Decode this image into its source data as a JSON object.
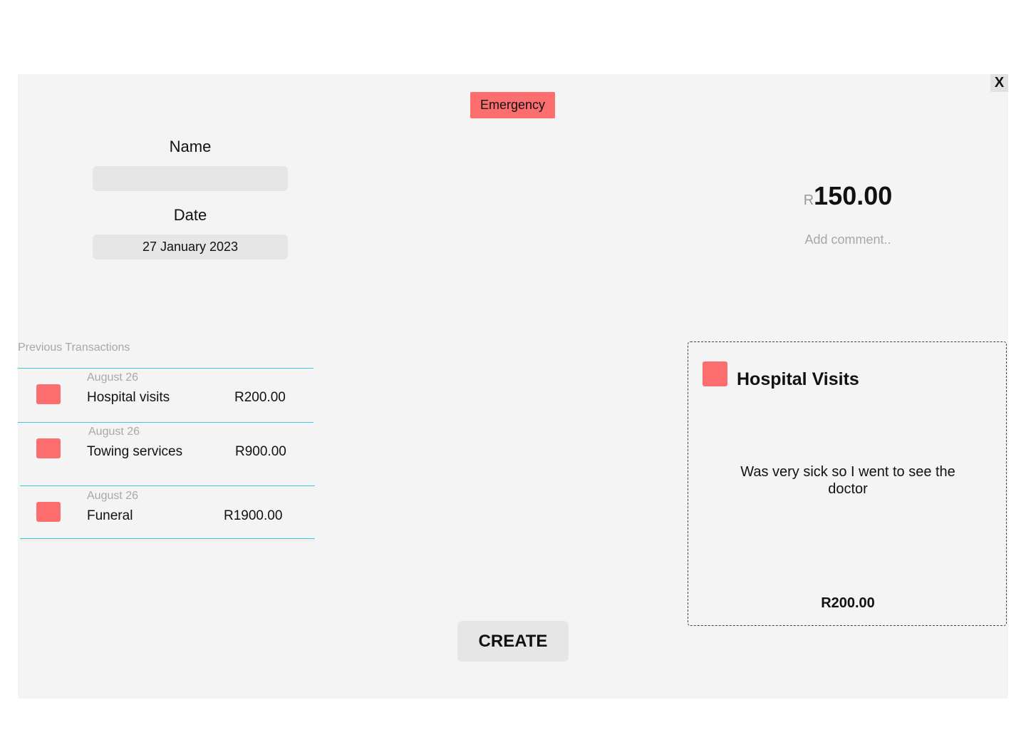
{
  "close": {
    "label": "X"
  },
  "category": {
    "label": "Emergency",
    "color": "#ff6e6e"
  },
  "form": {
    "name_label": "Name",
    "name_value": "",
    "date_label": "Date",
    "date_value": "27 January 2023"
  },
  "amount": {
    "currency": "R",
    "value": "150.00"
  },
  "comment": {
    "placeholder": "Add comment.."
  },
  "previous": {
    "title": "Previous Transactions",
    "items": [
      {
        "date": "August 26",
        "name": "Hospital visits",
        "amount": "R200.00"
      },
      {
        "date": "August 26",
        "name": "Towing services",
        "amount": "R900.00"
      },
      {
        "date": "August 26",
        "name": "Funeral",
        "amount": "R1900.00"
      }
    ]
  },
  "detail": {
    "title": "Hospital Visits",
    "description": "Was very sick so I went to see the doctor",
    "amount": "R200.00"
  },
  "actions": {
    "create_label": "CREATE"
  },
  "colors": {
    "accent": "#ff6e6e",
    "divider": "#3cc8dc",
    "panel": "#f4f4f4"
  }
}
